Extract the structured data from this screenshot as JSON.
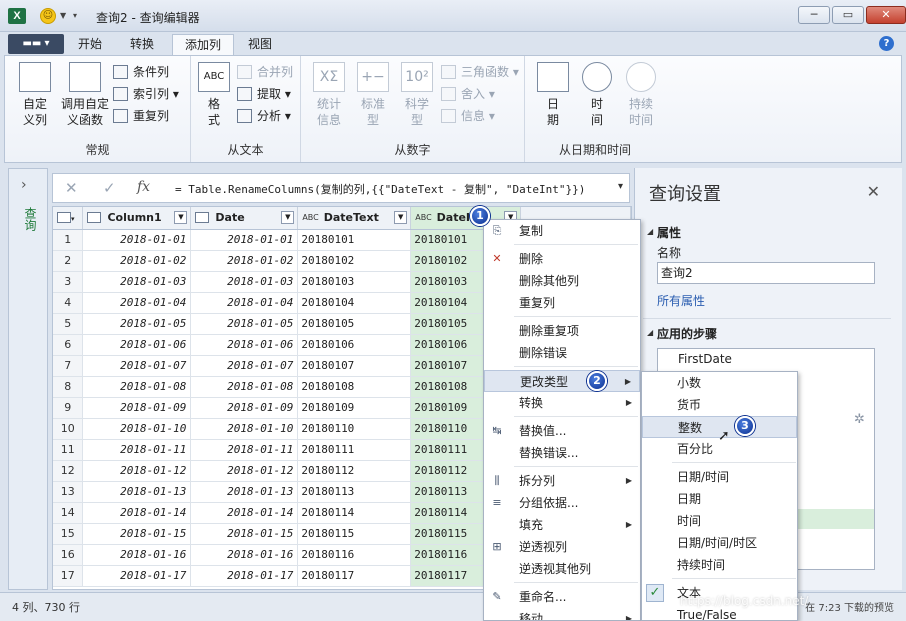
{
  "window": {
    "title": "查询2 - 查询编辑器"
  },
  "tabs": [
    "开始",
    "转换",
    "添加列",
    "视图"
  ],
  "active_tab": "添加列",
  "ribbon": {
    "general": {
      "label": "常规",
      "custom_column": "自定\n义列",
      "invoke_custom_function": "调用自定\n义函数",
      "conditional_column": "条件列",
      "index_column": "索引列",
      "duplicate_column": "重复列"
    },
    "from_text": {
      "label": "从文本",
      "format": "格\n式",
      "merge_columns": "合并列",
      "extract": "提取",
      "parse": "分析"
    },
    "from_number": {
      "label": "从数字",
      "statistics": "统计\n信息",
      "standard": "标准\n型",
      "scientific": "科学\n型",
      "trigonometry": "三角函数",
      "rounding": "舍入",
      "information": "信息"
    },
    "from_date_time": {
      "label": "从日期和时间",
      "date": "日\n期",
      "time": "时\n间",
      "duration": "持续\n时间"
    }
  },
  "nav": {
    "label": "查询"
  },
  "formula_bar": {
    "cancel": "✕",
    "accept": "✓",
    "fx": "fx",
    "formula": "= Table.RenameColumns(复制的列,{{\"DateText - 复制\", \"DateInt\"}})"
  },
  "grid": {
    "columns": [
      "Column1",
      "Date",
      "DateText",
      "DateInt"
    ],
    "rows": [
      [
        "1",
        "2018-01-01",
        "2018-01-01",
        "20180101",
        "20180101"
      ],
      [
        "2",
        "2018-01-02",
        "2018-01-02",
        "20180102",
        "20180102"
      ],
      [
        "3",
        "2018-01-03",
        "2018-01-03",
        "20180103",
        "20180103"
      ],
      [
        "4",
        "2018-01-04",
        "2018-01-04",
        "20180104",
        "20180104"
      ],
      [
        "5",
        "2018-01-05",
        "2018-01-05",
        "20180105",
        "20180105"
      ],
      [
        "6",
        "2018-01-06",
        "2018-01-06",
        "20180106",
        "20180106"
      ],
      [
        "7",
        "2018-01-07",
        "2018-01-07",
        "20180107",
        "20180107"
      ],
      [
        "8",
        "2018-01-08",
        "2018-01-08",
        "20180108",
        "20180108"
      ],
      [
        "9",
        "2018-01-09",
        "2018-01-09",
        "20180109",
        "20180109"
      ],
      [
        "10",
        "2018-01-10",
        "2018-01-10",
        "20180110",
        "20180110"
      ],
      [
        "11",
        "2018-01-11",
        "2018-01-11",
        "20180111",
        "20180111"
      ],
      [
        "12",
        "2018-01-12",
        "2018-01-12",
        "20180112",
        "20180112"
      ],
      [
        "13",
        "2018-01-13",
        "2018-01-13",
        "20180113",
        "20180113"
      ],
      [
        "14",
        "2018-01-14",
        "2018-01-14",
        "20180114",
        "20180114"
      ],
      [
        "15",
        "2018-01-15",
        "2018-01-15",
        "20180115",
        "20180115"
      ],
      [
        "16",
        "2018-01-16",
        "2018-01-16",
        "20180116",
        "20180116"
      ],
      [
        "17",
        "2018-01-17",
        "2018-01-17",
        "20180117",
        "20180117"
      ]
    ]
  },
  "context_menu": {
    "items": [
      {
        "label": "复制",
        "icon": "copy-icon"
      },
      {
        "label": "删除",
        "icon": "delete-icon"
      },
      {
        "label": "删除其他列",
        "icon": ""
      },
      {
        "label": "重复列",
        "icon": ""
      },
      {
        "label": "删除重复项",
        "icon": ""
      },
      {
        "label": "删除错误",
        "icon": ""
      },
      {
        "label": "更改类型",
        "icon": "",
        "submenu": true
      },
      {
        "label": "转换",
        "icon": "",
        "submenu": true
      },
      {
        "label": "替换值...",
        "icon": "replace-values-icon"
      },
      {
        "label": "替换错误...",
        "icon": ""
      },
      {
        "label": "拆分列",
        "icon": "split-column-icon",
        "submenu": true
      },
      {
        "label": "分组依据...",
        "icon": "group-by-icon"
      },
      {
        "label": "填充",
        "icon": "",
        "submenu": true
      },
      {
        "label": "逆透视列",
        "icon": "unpivot-icon"
      },
      {
        "label": "逆透视其他列",
        "icon": ""
      },
      {
        "label": "重命名...",
        "icon": "rename-icon"
      },
      {
        "label": "移动",
        "icon": "",
        "submenu": true
      }
    ]
  },
  "type_submenu": {
    "items": [
      "小数",
      "货币",
      "整数",
      "百分比",
      "日期/时间",
      "日期",
      "时间",
      "日期/时间/时区",
      "持续时间",
      "文本",
      "True/False"
    ],
    "checked": "文本",
    "highlighted": "整数"
  },
  "badges": [
    "1",
    "2",
    "3"
  ],
  "query_settings": {
    "title": "查询设置",
    "properties_heading": "属性",
    "name_label": "名称",
    "name_value": "查询2",
    "all_properties": "所有属性",
    "steps_heading": "应用的步骤",
    "first_step": "FirstDate"
  },
  "status": {
    "left": "4 列、730 行",
    "right": "在 7:23 下载的预览"
  },
  "watermark": "https://blog.csdn.net/"
}
